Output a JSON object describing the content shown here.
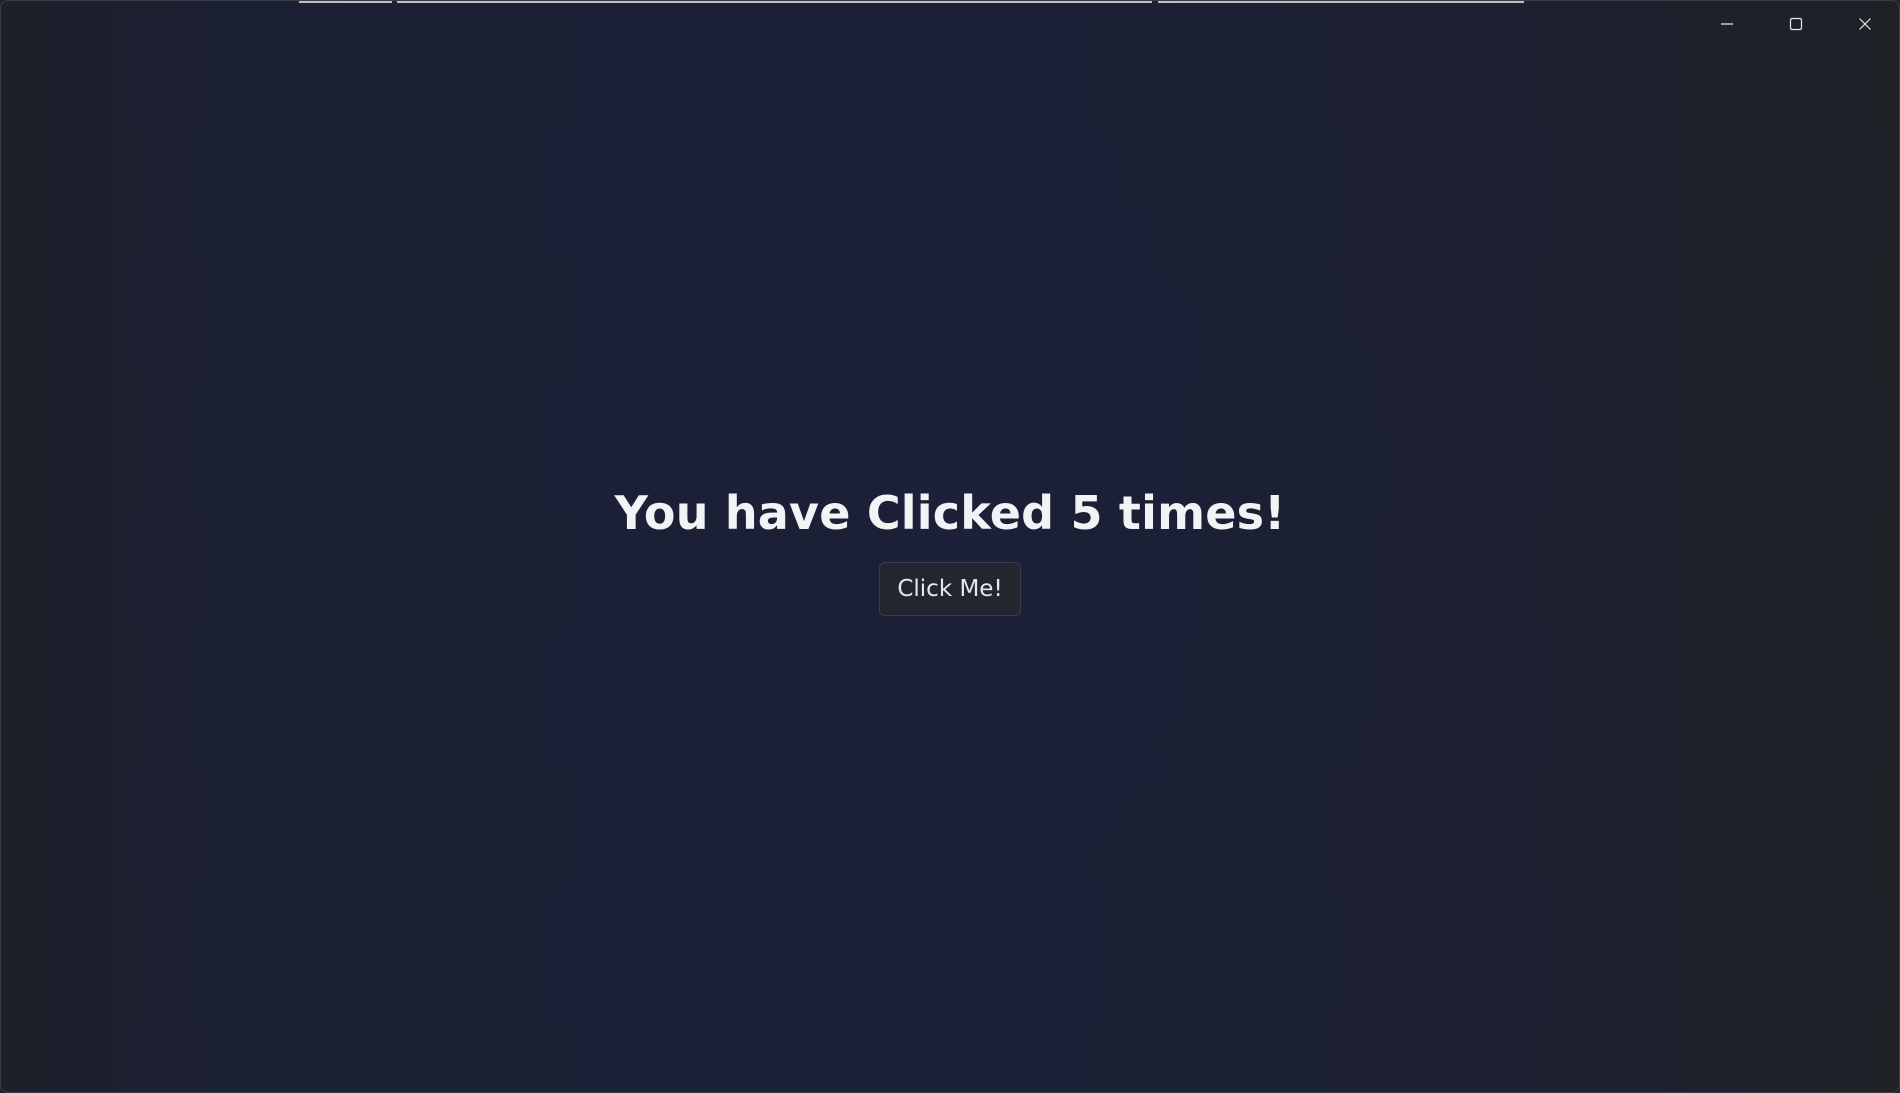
{
  "window": {
    "controls": {
      "minimize_icon": "minimize-icon",
      "maximize_icon": "maximize-icon",
      "close_icon": "close-icon"
    }
  },
  "main": {
    "headline": "You have Clicked 5 times!",
    "button_label": "Click Me!"
  },
  "colors": {
    "background": "#1b2037",
    "text": "#f2f3f5",
    "button_bg": "#23262f",
    "button_border": "#3a3e4a"
  }
}
